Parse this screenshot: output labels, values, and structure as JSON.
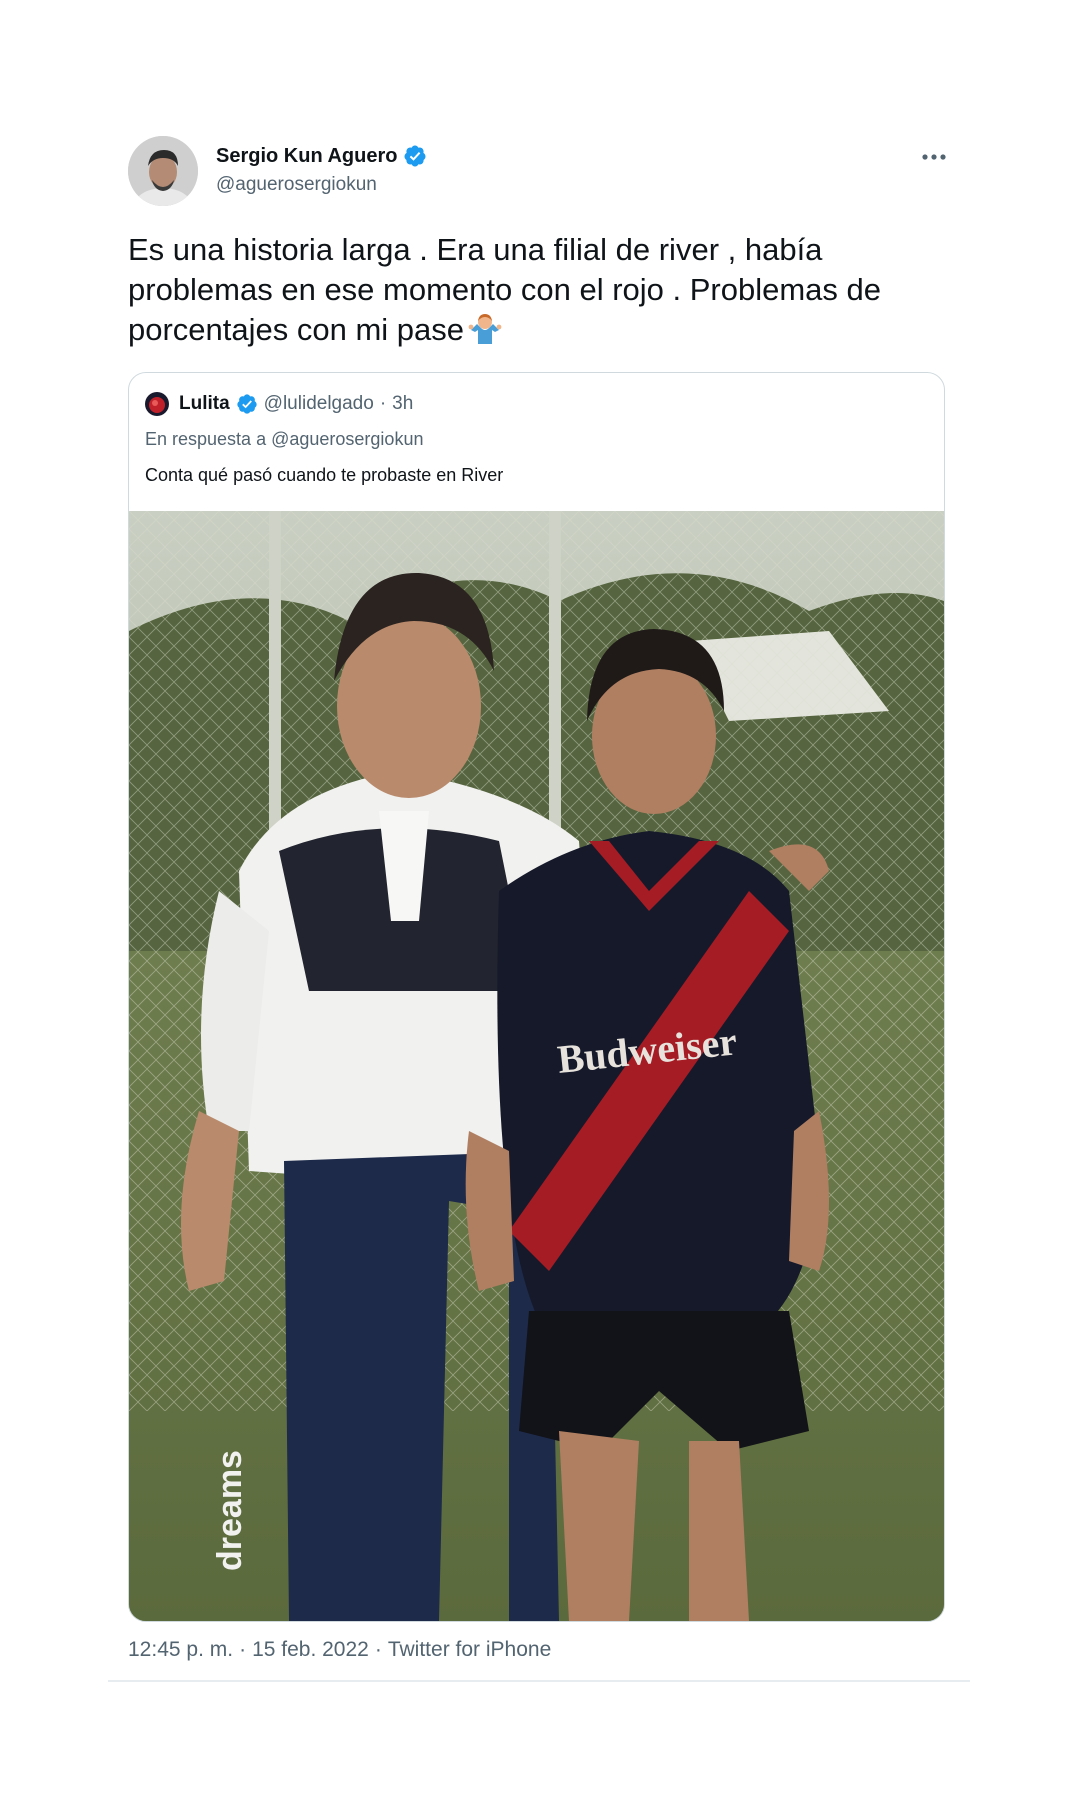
{
  "author": {
    "display_name": "Sergio Kun Aguero",
    "handle": "@aguerosergiokun",
    "verified": true,
    "avatar_icon": "profile-photo"
  },
  "more_icon": "ellipsis-icon",
  "tweet": {
    "text": "Es una historia larga . Era una filial de river , había problemas en ese momento con el rojo . Problemas de porcentajes con mi pase",
    "emoji": "person-shrugging-emoji"
  },
  "quoted": {
    "display_name": "Lulita",
    "handle": "@lulidelgado",
    "separator": "·",
    "time": "3h",
    "reply_prefix": "En respuesta a",
    "reply_mention": "@aguerosergiokun",
    "text": "Conta qué pasó cuando te probaste en River",
    "image": {
      "description_icon": "photo-image",
      "jersey_text": "Budweiser",
      "pants_text": "dreams"
    }
  },
  "footer": {
    "time": "12:45 p. m.",
    "separator_1": "·",
    "date": "15 feb. 2022",
    "separator_2": "·",
    "source": "Twitter for iPhone"
  },
  "colors": {
    "text_primary": "#0f1419",
    "text_secondary": "#536471",
    "verified_blue": "#1d9bf0",
    "border": "#cfd9de"
  }
}
